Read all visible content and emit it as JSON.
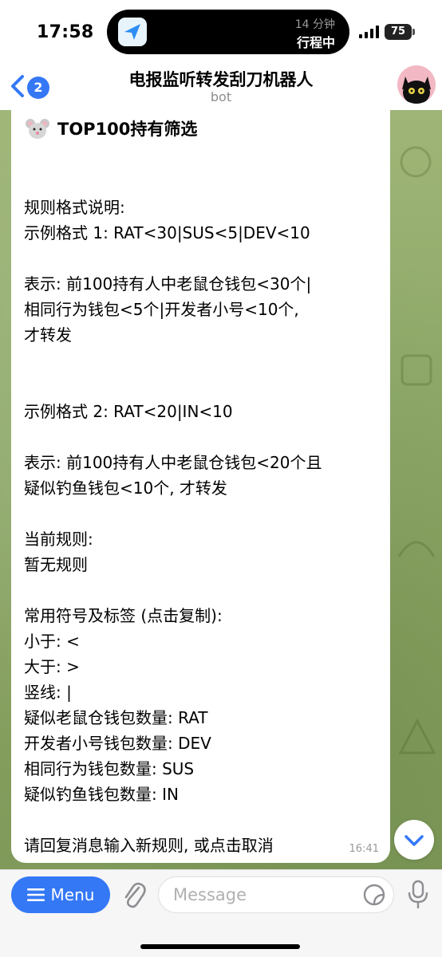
{
  "status_bar": {
    "time": "17:58",
    "island_minutes": "14 分钟",
    "island_status": "行程中",
    "battery": "75"
  },
  "header": {
    "back_badge": "2",
    "title": "电报监听转发刮刀机器人",
    "subtitle": "bot"
  },
  "message": {
    "heading": "TOP100持有筛选",
    "lines": [
      "规则格式说明:",
      "示例格式 1: RAT<30|SUS<5|DEV<10",
      "表示: 前100持有人中老鼠仓钱包<30个|",
      "相同行为钱包<5个|开发者小号<10个,",
      "才转发",
      "示例格式 2: RAT<20|IN<10",
      "表示: 前100持有人中老鼠仓钱包<20个且",
      "疑似钓鱼钱包<10个, 才转发",
      "当前规则:",
      "暂无规则",
      "常用符号及标签 (点击复制):",
      "小于: <",
      "大于: >",
      "竖线: |",
      "疑似老鼠仓钱包数量: RAT",
      "开发者小号钱包数量: DEV",
      "相同行为钱包数量: SUS",
      "疑似钓鱼钱包数量: IN",
      "请回复消息输入新规则, 或点击取消"
    ],
    "time": "16:41"
  },
  "input_bar": {
    "menu_label": "Menu",
    "placeholder": "Message"
  },
  "colors": {
    "accent": "#3478f6",
    "wallpaper": "#8faa6a",
    "bubble": "#ffffff"
  }
}
